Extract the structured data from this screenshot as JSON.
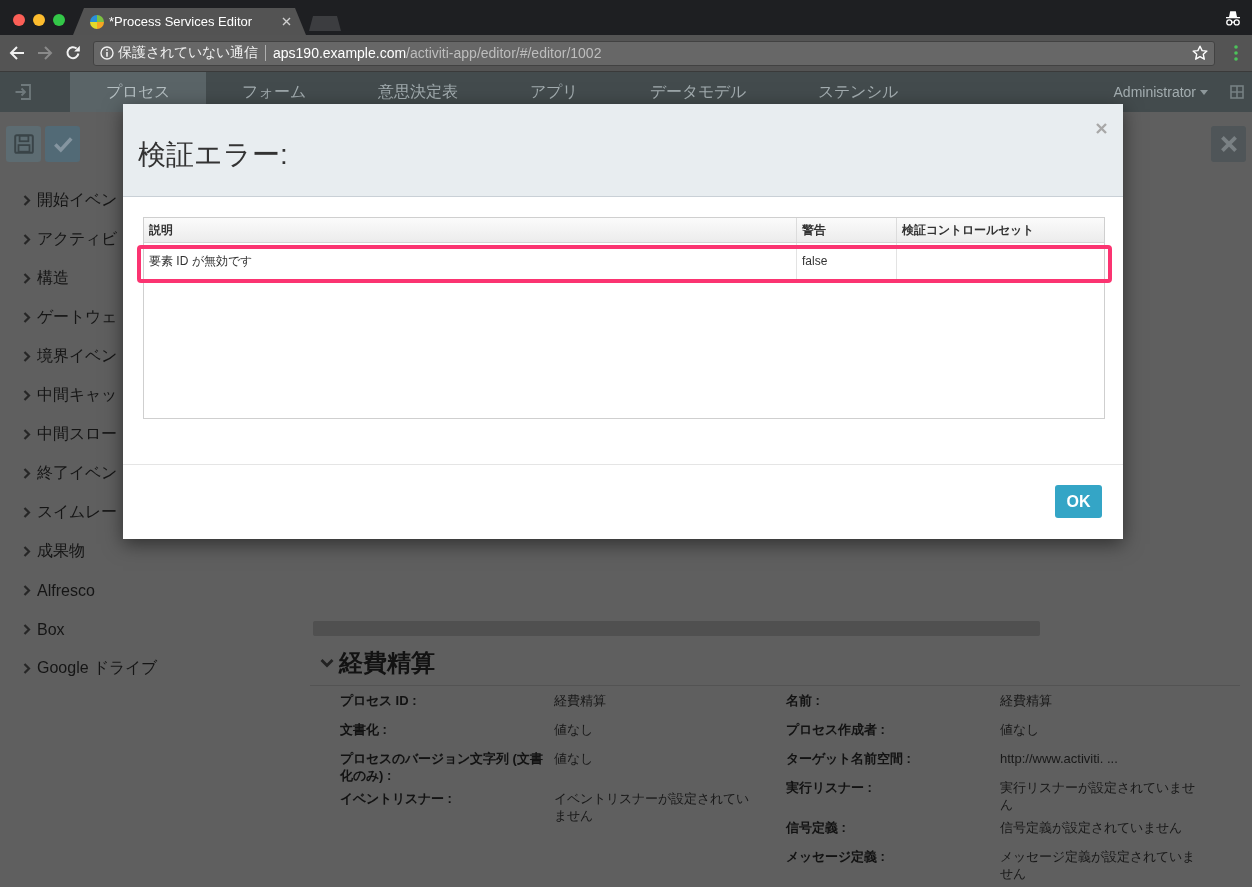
{
  "browser": {
    "tabs": [
      {
        "title": "*Process Services Editor",
        "selected": true
      }
    ],
    "nav_buttons": [
      {
        "kind": "back",
        "disabled": false
      },
      {
        "kind": "forward",
        "disabled": true
      },
      {
        "kind": "reload",
        "disabled": false
      }
    ],
    "address_bar": {
      "security_label": "保護されていない通信",
      "host": "aps190.example.com",
      "path": "/activiti-app/editor/#/editor/1002"
    }
  },
  "app_nav": {
    "items": [
      {
        "label": "プロセス",
        "selected": true
      },
      {
        "label": "フォーム",
        "selected": false
      },
      {
        "label": "意思決定表",
        "selected": false
      },
      {
        "label": "アプリ",
        "selected": false
      },
      {
        "label": "データモデル",
        "selected": false
      },
      {
        "label": "ステンシル",
        "selected": false
      }
    ],
    "user": "Administrator"
  },
  "palette": {
    "items": [
      {
        "label": "開始イベン",
        "expanded": false
      },
      {
        "label": "アクティビ",
        "expanded": false
      },
      {
        "label": "構造",
        "expanded": false
      },
      {
        "label": "ゲートウェ",
        "expanded": false
      },
      {
        "label": "境界イベン",
        "expanded": false
      },
      {
        "label": "中間キャッ",
        "expanded": false
      },
      {
        "label": "中間スロー",
        "expanded": false
      },
      {
        "label": "終了イベン",
        "expanded": false
      },
      {
        "label": "スイムレー",
        "expanded": false
      },
      {
        "label": "成果物",
        "expanded": false
      },
      {
        "label": "Alfresco",
        "expanded": false
      },
      {
        "label": "Box",
        "expanded": false
      },
      {
        "label": "Google ドライブ",
        "expanded": false
      }
    ]
  },
  "properties": {
    "title": "経費精算",
    "expanded": true,
    "left_fields": [
      {
        "label": "プロセス ID :",
        "value": "経費精算"
      },
      {
        "label": "文書化 :",
        "value": "値なし"
      },
      {
        "label": "プロセスのバージョン文字列 (文書化のみ) :",
        "value": "値なし"
      },
      {
        "label": "イベントリスナー :",
        "value": "イベントリスナーが設定されていません"
      }
    ],
    "right_fields": [
      {
        "label": "名前 :",
        "value": "経費精算"
      },
      {
        "label": "プロセス作成者 :",
        "value": "値なし"
      },
      {
        "label": "ターゲット名前空間 :",
        "value": "http://www.activiti. ..."
      },
      {
        "label": "実行リスナー :",
        "value": "実行リスナーが設定されていません"
      },
      {
        "label": "信号定義 :",
        "value": "信号定義が設定されていません"
      },
      {
        "label": "メッセージ定義 :",
        "value": "メッセージ定義が設定されていません"
      }
    ]
  },
  "dialog": {
    "title": "検証エラー:",
    "columns": [
      "説明",
      "警告",
      "検証コントロールセット"
    ],
    "rows": [
      {
        "cells": [
          "要素 ID が無効です",
          "false"
        ],
        "highlighted": true
      }
    ],
    "ok_button": "OK"
  }
}
